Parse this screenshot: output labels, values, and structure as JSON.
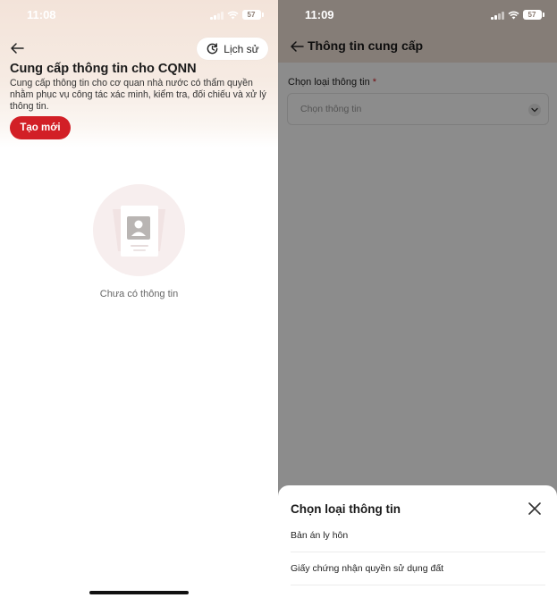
{
  "left": {
    "status_time": "11:08",
    "battery": "57",
    "history_button": "Lịch sử",
    "title": "Cung cấp thông tin cho CQNN",
    "description": "Cung cấp thông tin cho cơ quan nhà nước có thẩm quyền nhằm phục vụ công tác xác minh, kiểm tra, đối chiếu và xử lý thông tin.",
    "create_button": "Tạo mới",
    "empty_text": "Chưa có thông tin"
  },
  "right": {
    "status_time": "11:09",
    "battery": "57",
    "header_title": "Thông tin cung cấp",
    "field_label": "Chọn loại thông tin",
    "required_mark": "*",
    "select_placeholder": "Chọn thông tin",
    "sheet": {
      "title": "Chọn loại thông tin",
      "items": [
        {
          "label": "Bản án ly hôn"
        },
        {
          "label": "Giấy chứng nhận quyền sử dụng đất"
        }
      ]
    }
  },
  "colors": {
    "accent": "#d21f26",
    "header_bg": "#f3e3d9",
    "overlay": "rgba(0,0,0,0.45)"
  }
}
